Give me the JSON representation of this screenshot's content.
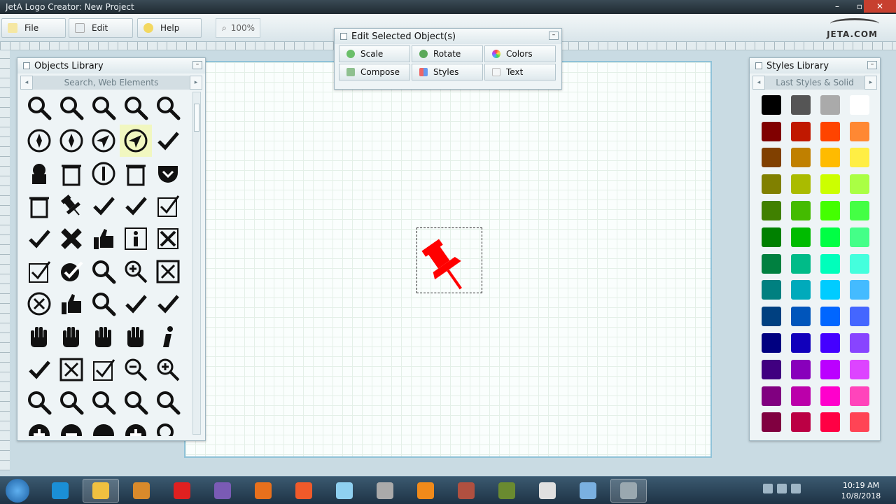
{
  "window": {
    "title": "JetA Logo Creator: New Project",
    "min": "–",
    "max": "▫",
    "close": "✕"
  },
  "menubar": {
    "file": "File",
    "edit": "Edit",
    "help": "Help",
    "zoom": "100%",
    "logo": "JETA.COM"
  },
  "objects_panel": {
    "title": "Objects Library",
    "search": "Search, Web Elements",
    "prev": "◂",
    "next": "▸",
    "icons": [
      "search-icon",
      "search-icon",
      "search-icon",
      "search-icon",
      "search-icon",
      "compass-icon",
      "compass-icon",
      "navigation-icon",
      "navigation-icon",
      "checkmark-icon",
      "cupcake-icon",
      "trash-icon",
      "info-circle-icon",
      "trash-icon",
      "pocket-icon",
      "trash-icon",
      "pushpin-icon",
      "checkmark-icon",
      "checkmark-icon",
      "checkbox-checked-icon",
      "checkmark-icon",
      "close-x-icon",
      "thumbs-up-icon",
      "info-icon",
      "checkbox-x-icon",
      "checkbox-checked-icon",
      "check-circle-icon",
      "search-icon",
      "zoom-in-icon",
      "close-box-icon",
      "close-circle-icon",
      "thumbs-up-icon",
      "search-icon",
      "checkmark-icon",
      "checkmark-icon",
      "hand-icon",
      "hand-icon",
      "hand-icon",
      "hand-icon",
      "info-italic-icon",
      "checkmark-icon",
      "close-box-icon",
      "checkbox-checked-icon",
      "zoom-out-icon",
      "zoom-in-icon",
      "search-icon",
      "search-icon",
      "search-icon",
      "search-icon",
      "search-icon",
      "plus-circle-icon",
      "minus-circle-icon",
      "record-icon",
      "plus-circle-icon",
      "search-icon"
    ]
  },
  "edit_panel": {
    "title": "Edit Selected Object(s)",
    "buttons": [
      "Scale",
      "Rotate",
      "Colors",
      "Compose",
      "Styles",
      "Text"
    ]
  },
  "styles_panel": {
    "title": "Styles Library",
    "search": "Last Styles & Solid",
    "prev": "◂",
    "next": "▸",
    "swatches": [
      "#000000",
      "#555555",
      "#aaaaaa",
      "#ffffff",
      "#800000",
      "#c01800",
      "#ff4400",
      "#ff8833",
      "#804000",
      "#c08000",
      "#ffbb00",
      "#ffee44",
      "#808000",
      "#aabb00",
      "#ccff00",
      "#aaff44",
      "#408000",
      "#44bb00",
      "#44ff00",
      "#44ff44",
      "#008000",
      "#00bb00",
      "#00ff44",
      "#44ff88",
      "#008040",
      "#00bb88",
      "#00ffbb",
      "#44ffdd",
      "#008080",
      "#00aabb",
      "#00ccff",
      "#44bbff",
      "#004080",
      "#0055bb",
      "#0066ff",
      "#4466ff",
      "#000080",
      "#1100bb",
      "#4400ff",
      "#8844ff",
      "#400080",
      "#8800bb",
      "#bb00ff",
      "#dd44ff",
      "#800080",
      "#bb00aa",
      "#ff00cc",
      "#ff44bb",
      "#800040",
      "#bb0044",
      "#ff0044",
      "#ff4455"
    ]
  },
  "canvas": {
    "selected_object": "pushpin-icon",
    "accent": "#ff0000"
  },
  "taskbar": {
    "apps": [
      "internet-explorer-icon",
      "file-explorer-icon",
      "media-player-icon",
      "opera-icon",
      "visual-studio-icon",
      "firefox-icon",
      "app-icon",
      "app-icon",
      "app-icon",
      "blender-icon",
      "app-icon",
      "mw-icon",
      "inkscape-icon",
      "calculator-icon",
      "jeta-icon"
    ],
    "time": "10:19 AM",
    "date": "10/8/2018"
  }
}
